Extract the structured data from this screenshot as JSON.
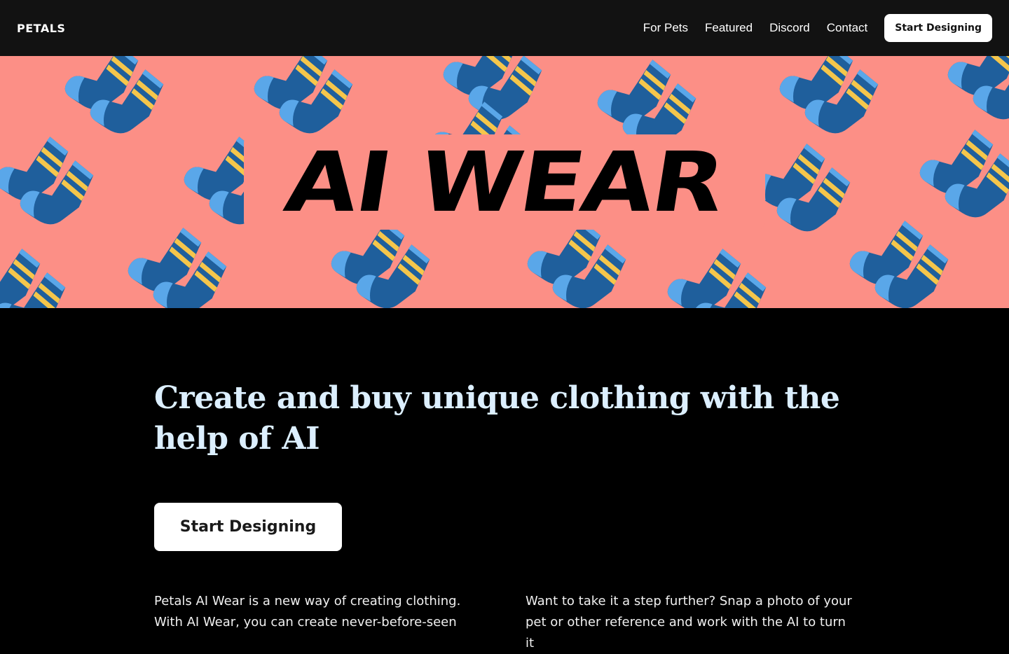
{
  "nav": {
    "brand": "PETALS",
    "links": [
      "For Pets",
      "Featured",
      "Discord",
      "Contact"
    ],
    "cta": "Start Designing"
  },
  "hero": {
    "title": "AI WEAR",
    "background_color": "#fc8f86",
    "pattern_icon": "sock-icon",
    "sock_colors": {
      "body": "#1f5f9c",
      "toe": "#5aa7e9",
      "stripe": "#f5c64b"
    }
  },
  "main": {
    "headline": "Create and buy unique clothing with the help of AI",
    "cta": "Start Designing",
    "paragraph_left": "Petals AI Wear is a new way of creating clothing. With AI Wear, you can create never-before-seen",
    "paragraph_right": "Want to take it a step further? Snap a photo of your pet or other reference and work with the AI to turn it"
  },
  "colors": {
    "nav_background": "#121212",
    "page_background": "#000000",
    "headline": "#dcefff"
  }
}
